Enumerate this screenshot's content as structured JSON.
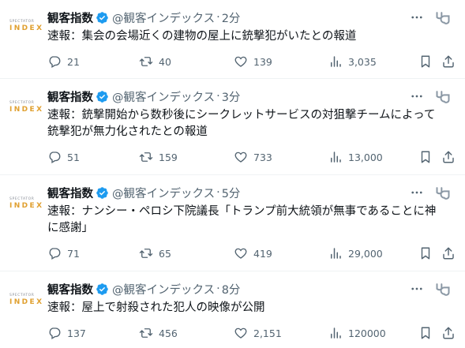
{
  "tweets": [
    {
      "name": "観客指数",
      "handle": "@観客インデックス",
      "time": "2分",
      "text": "速報：集会の会場近くの建物の屋上に銃撃犯がいたとの報道",
      "replies": "21",
      "retweets": "40",
      "likes": "139",
      "views": "3,035"
    },
    {
      "name": "観客指数",
      "handle": "@観客インデックス",
      "time": "3分",
      "text": "速報：銃撃開始から数秒後にシークレットサービスの対狙撃チームによって\n銃撃犯が無力化されたとの報道",
      "replies": "51",
      "retweets": "159",
      "likes": "733",
      "views": "13,000"
    },
    {
      "name": "観客指数",
      "handle": "@観客インデックス",
      "time": "5分",
      "text": "速報：ナンシー・ペロシ下院議長「トランプ前大統領が無事であることに神\nに感謝」",
      "replies": "71",
      "retweets": "65",
      "likes": "419",
      "views": "29,000"
    },
    {
      "name": "観客指数",
      "handle": "@観客インデックス",
      "time": "8分",
      "text": "速報：屋上で射殺された犯人の映像が公開",
      "replies": "137",
      "retweets": "456",
      "likes": "2,151",
      "views": "120000"
    }
  ],
  "avatar": {
    "top": "SPECTATOR",
    "bottom": "INDEX"
  },
  "separator": "·",
  "icons": {
    "verified": "verified-badge-icon",
    "more": "more-dots-icon",
    "grok": "grok-icon",
    "reply": "reply-icon",
    "retweet": "retweet-icon",
    "like": "heart-icon",
    "views": "views-chart-icon",
    "bookmark": "bookmark-icon",
    "share": "share-icon"
  },
  "colors": {
    "verified": "#1d9bf0",
    "muted": "#536471",
    "text": "#0f1419",
    "avatarAccent": "#e0a030"
  }
}
